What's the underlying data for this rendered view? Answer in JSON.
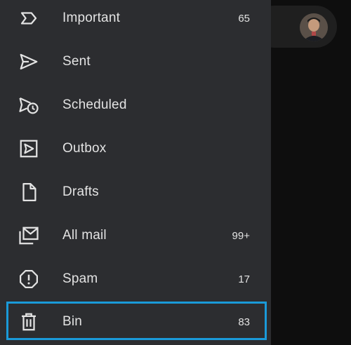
{
  "drawer": {
    "items": [
      {
        "label": "Important",
        "count": "65",
        "icon": "label-important-icon"
      },
      {
        "label": "Sent",
        "count": "",
        "icon": "send-icon"
      },
      {
        "label": "Scheduled",
        "count": "",
        "icon": "schedule-send-icon"
      },
      {
        "label": "Outbox",
        "count": "",
        "icon": "outbox-icon"
      },
      {
        "label": "Drafts",
        "count": "",
        "icon": "draft-icon"
      },
      {
        "label": "All mail",
        "count": "99+",
        "icon": "all-mail-icon"
      },
      {
        "label": "Spam",
        "count": "17",
        "icon": "report-icon"
      },
      {
        "label": "Bin",
        "count": "83",
        "icon": "delete-icon"
      }
    ],
    "selected": "Bin"
  },
  "colors": {
    "drawer_bg": "#2c2d30",
    "text": "#e3e3e3",
    "highlight_border": "#1a9ad9",
    "backdrop": "#0e0e0e"
  },
  "header": {
    "avatar_icon": "account-avatar"
  }
}
